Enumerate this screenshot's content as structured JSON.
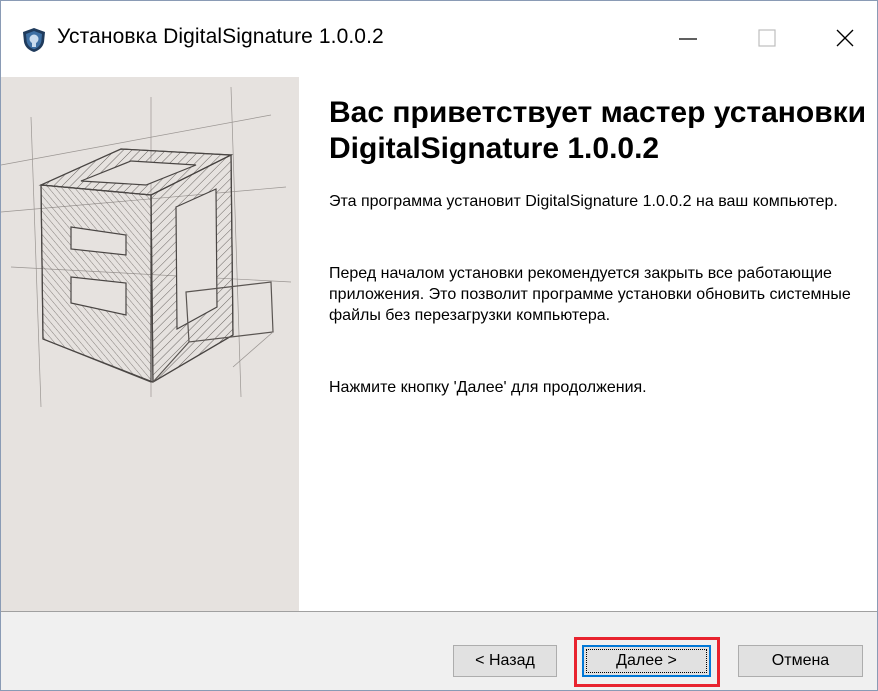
{
  "window": {
    "title": "Установка DigitalSignature  1.0.0.2",
    "controls": {
      "minimize": "minimize",
      "maximize": "maximize",
      "close": "close"
    }
  },
  "content": {
    "heading": "Вас приветствует мастер установки DigitalSignature  1.0.0.2",
    "paragraph1": "Эта программа установит DigitalSignature  1.0.0.2 на ваш компьютер.",
    "paragraph2": "Перед началом установки рекомендуется закрыть все работающие приложения. Это позволит программе установки обновить системные файлы без перезагрузки компьютера.",
    "paragraph3": "Нажмите кнопку 'Далее' для продолжения."
  },
  "footer": {
    "back_label": "< Назад",
    "next_label": "Далее >",
    "cancel_label": "Отмена"
  },
  "icons": {
    "app": "shield-app-icon",
    "sidebar": "sketch-cube-illustration"
  },
  "colors": {
    "sidebar_bg": "#e6e2df",
    "footer_bg": "#f0f0f0",
    "focus_blue": "#0078d7",
    "highlight_red": "#e8232e",
    "shield_dark": "#1f3b5c"
  }
}
